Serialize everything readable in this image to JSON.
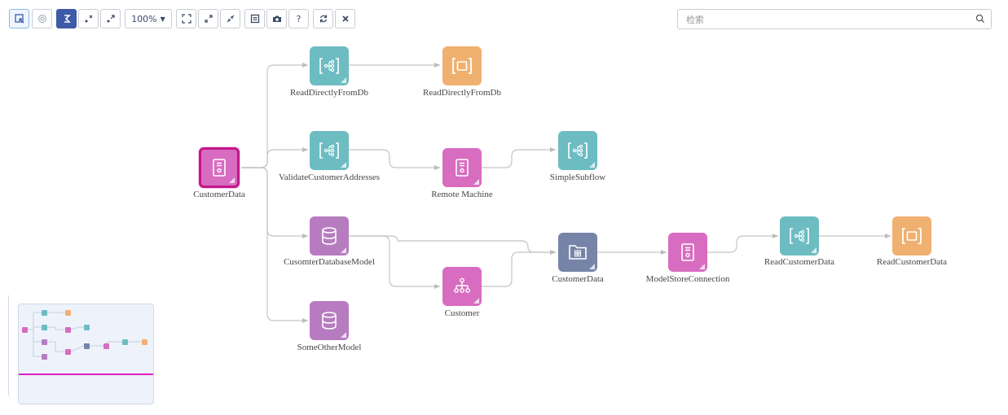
{
  "toolbar": {
    "zoom_label": "100%",
    "help_label": "?"
  },
  "search": {
    "placeholder": "检索"
  },
  "nodes": {
    "customer_data_src": "CustomerData",
    "read_directly_1": "ReadDirectlyFromDb",
    "read_directly_2": "ReadDirectlyFromDb",
    "validate_addresses": "ValidateCustomerAddresses",
    "remote_machine": "Remote Machine",
    "simple_subflow": "SimpleSubflow",
    "cusomter_db_model": "CusomterDatabaseModel",
    "customer": "Customer",
    "customer_data_folder": "CustomerData",
    "model_store_connection": "ModelStoreConnection",
    "read_customer_data_1": "ReadCustomerData",
    "read_customer_data_2": "ReadCustomerData",
    "some_other_model": "SomeOtherModel"
  },
  "colors": {
    "teal": "#6cbcc2",
    "orange": "#f0b070",
    "magenta": "#d86cc0",
    "purple": "#b77cc0",
    "slate": "#7684a8",
    "selection": "#c2188a",
    "toolbar_active": "#3e5aa8"
  }
}
